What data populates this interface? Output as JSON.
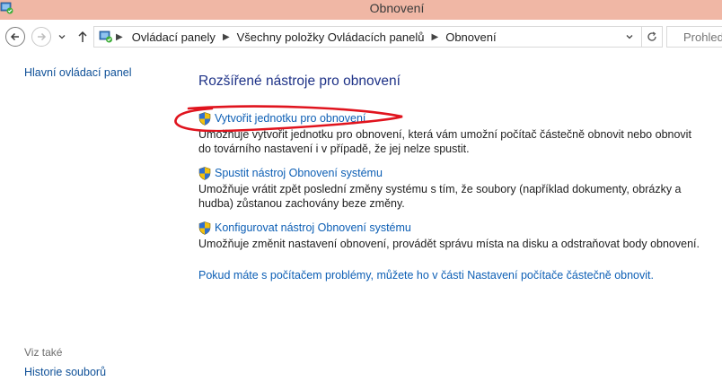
{
  "window": {
    "title": "Obnovení"
  },
  "nav": {
    "breadcrumbs": [
      "Ovládací panely",
      "Všechny položky Ovládacích panelů",
      "Obnovení"
    ],
    "search_placeholder": "Prohled"
  },
  "sidebar": {
    "home_link": "Hlavní ovládací panel",
    "see_also_label": "Viz také",
    "see_also_items": [
      "Historie souborů"
    ]
  },
  "main": {
    "title": "Rozšířené nástroje pro obnovení",
    "tools": [
      {
        "label": "Vytvořit jednotku pro obnovení",
        "description": "Umožňuje vytvořit jednotku pro obnovení, která vám umožní počítač částečně obnovit nebo obnovit do továrního nastavení i v případě, že jej nelze spustit."
      },
      {
        "label": "Spustit nástroj Obnovení systému",
        "description": "Umožňuje vrátit zpět poslední změny systému s tím, že soubory (například dokumenty, obrázky a hudba) zůstanou zachovány beze změny."
      },
      {
        "label": "Konfigurovat nástroj Obnovení systému",
        "description": "Umožňuje změnit nastavení obnovení, provádět správu místa na disku a odstraňovat body obnovení."
      }
    ],
    "bottom_link": "Pokud máte s počítačem problémy, můžete ho v části Nastavení počítače částečně obnovit."
  },
  "colors": {
    "titlebar": "#f0b7a5",
    "link": "#0d5fb5",
    "heading": "#1e3287",
    "annotation": "#e0141e"
  },
  "icons": {
    "app": "control-panel-icon",
    "tool": "uac-shield-icon"
  }
}
